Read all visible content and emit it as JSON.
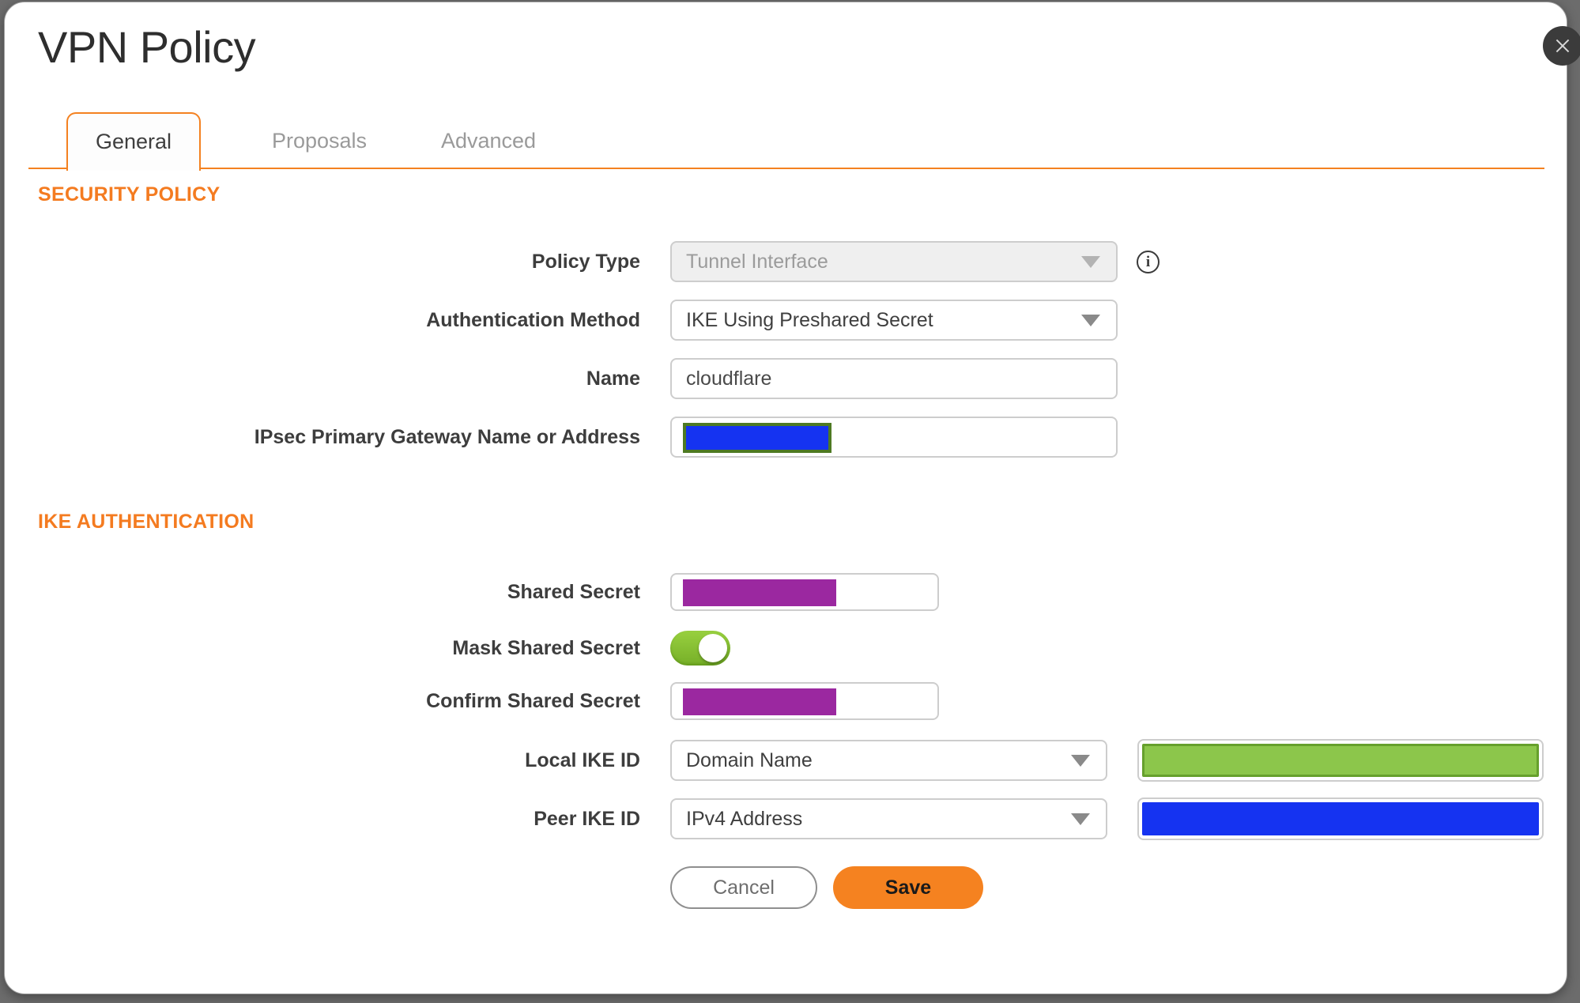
{
  "dialog": {
    "title": "VPN Policy"
  },
  "tabs": [
    {
      "label": "General",
      "active": true
    },
    {
      "label": "Proposals",
      "active": false
    },
    {
      "label": "Advanced",
      "active": false
    }
  ],
  "sections": {
    "security_policy": "SECURITY POLICY",
    "ike_authentication": "IKE AUTHENTICATION"
  },
  "fields": {
    "policy_type": {
      "label": "Policy Type",
      "value": "Tunnel Interface",
      "state": "disabled"
    },
    "authentication_method": {
      "label": "Authentication Method",
      "value": "IKE Using Preshared Secret"
    },
    "name": {
      "label": "Name",
      "value": "cloudflare"
    },
    "ipsec_gateway": {
      "label": "IPsec Primary Gateway Name or Address",
      "value": "",
      "redaction_color": "#1533F1",
      "redaction_border": "#4E7A23"
    },
    "shared_secret": {
      "label": "Shared Secret",
      "value": "",
      "redaction_color": "#9B28A0"
    },
    "mask_shared_secret": {
      "label": "Mask Shared Secret",
      "state": "on"
    },
    "confirm_shared_secret": {
      "label": "Confirm Shared Secret",
      "value": "",
      "redaction_color": "#9B28A0"
    },
    "local_ike_id": {
      "label": "Local IKE ID",
      "value": "Domain Name",
      "redaction_color": "#8CC64B",
      "redaction_border": "#66A02C"
    },
    "peer_ike_id": {
      "label": "Peer IKE ID",
      "value": "IPv4 Address",
      "redaction_color": "#1533F1"
    }
  },
  "icons": {
    "close": "x-mark",
    "info": "info-circle",
    "dropdown": "caret-down"
  },
  "buttons": {
    "cancel": "Cancel",
    "save": "Save"
  },
  "colors": {
    "accent_orange": "#F47B20",
    "tab_border_orange": "#F48120",
    "save_button_orange": "#F58220",
    "toggle_green": "#8CC63F",
    "backdrop_gray": "#6C6C6C",
    "close_button_gray": "#3B3B3B"
  }
}
